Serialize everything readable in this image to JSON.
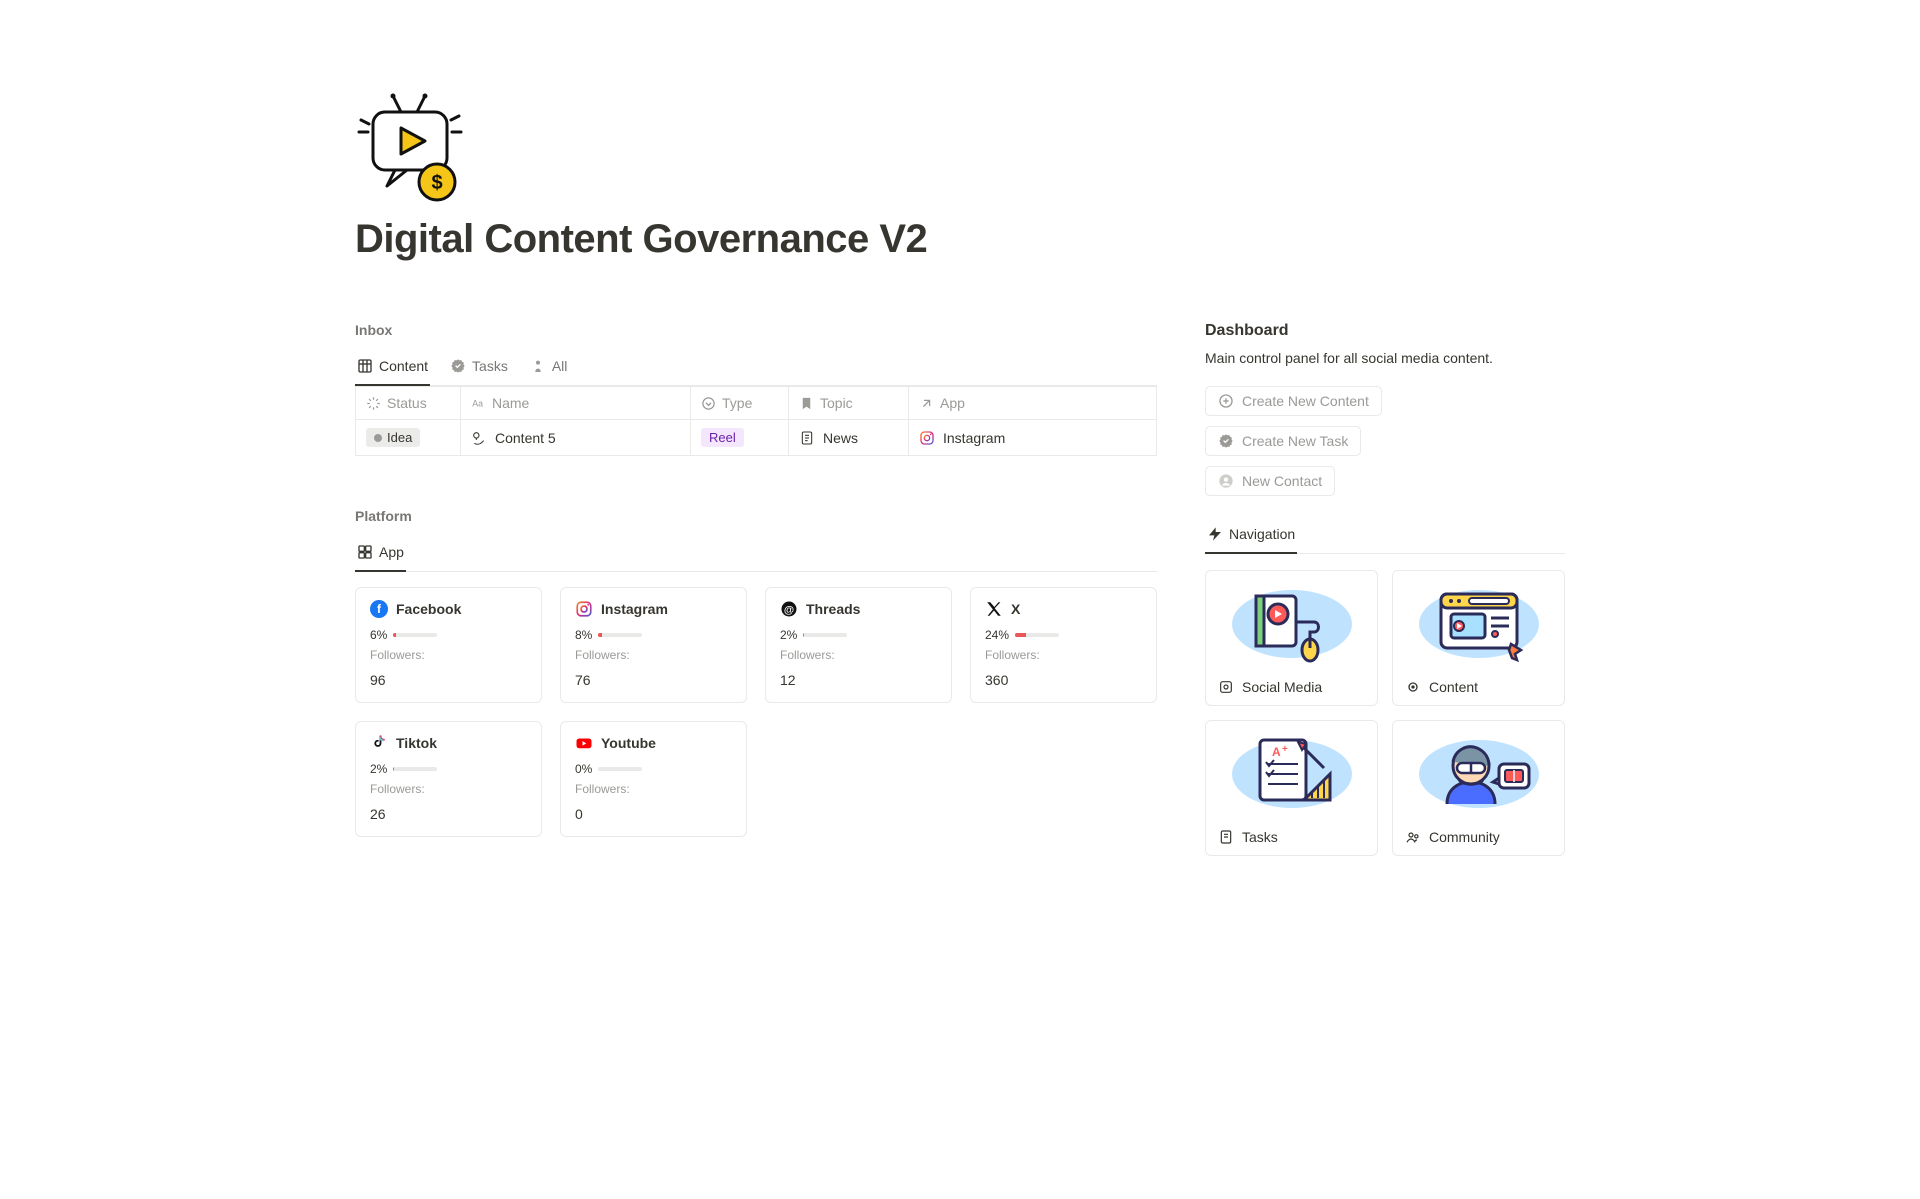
{
  "page": {
    "title": "Digital Content Governance V2"
  },
  "inbox": {
    "label": "Inbox",
    "tabs": {
      "content": "Content",
      "tasks": "Tasks",
      "all": "All"
    },
    "columns": {
      "status": "Status",
      "name": "Name",
      "type": "Type",
      "topic": "Topic",
      "app": "App"
    },
    "row": {
      "status": "Idea",
      "name": "Content 5",
      "type": "Reel",
      "topic": "News",
      "app": "Instagram"
    }
  },
  "platform": {
    "label": "Platform",
    "tab": "App",
    "followers_label": "Followers:",
    "apps": [
      {
        "name": "Facebook",
        "pct": "6%",
        "fill": 6,
        "followers": "96"
      },
      {
        "name": "Instagram",
        "pct": "8%",
        "fill": 8,
        "followers": "76"
      },
      {
        "name": "Threads",
        "pct": "2%",
        "fill": 2,
        "followers": "12"
      },
      {
        "name": "X",
        "pct": "24%",
        "fill": 24,
        "followers": "360"
      },
      {
        "name": "Tiktok",
        "pct": "2%",
        "fill": 2,
        "followers": "26"
      },
      {
        "name": "Youtube",
        "pct": "0%",
        "fill": 0,
        "followers": "0"
      }
    ]
  },
  "dashboard": {
    "title": "Dashboard",
    "subtitle": "Main control panel for all social media content.",
    "actions": {
      "new_content": "Create New Content",
      "new_task": "Create New Task",
      "new_contact": "New Contact"
    },
    "nav_tab": "Navigation",
    "nav": [
      {
        "label": "Social Media"
      },
      {
        "label": "Content"
      },
      {
        "label": "Tasks"
      },
      {
        "label": "Community"
      }
    ]
  }
}
